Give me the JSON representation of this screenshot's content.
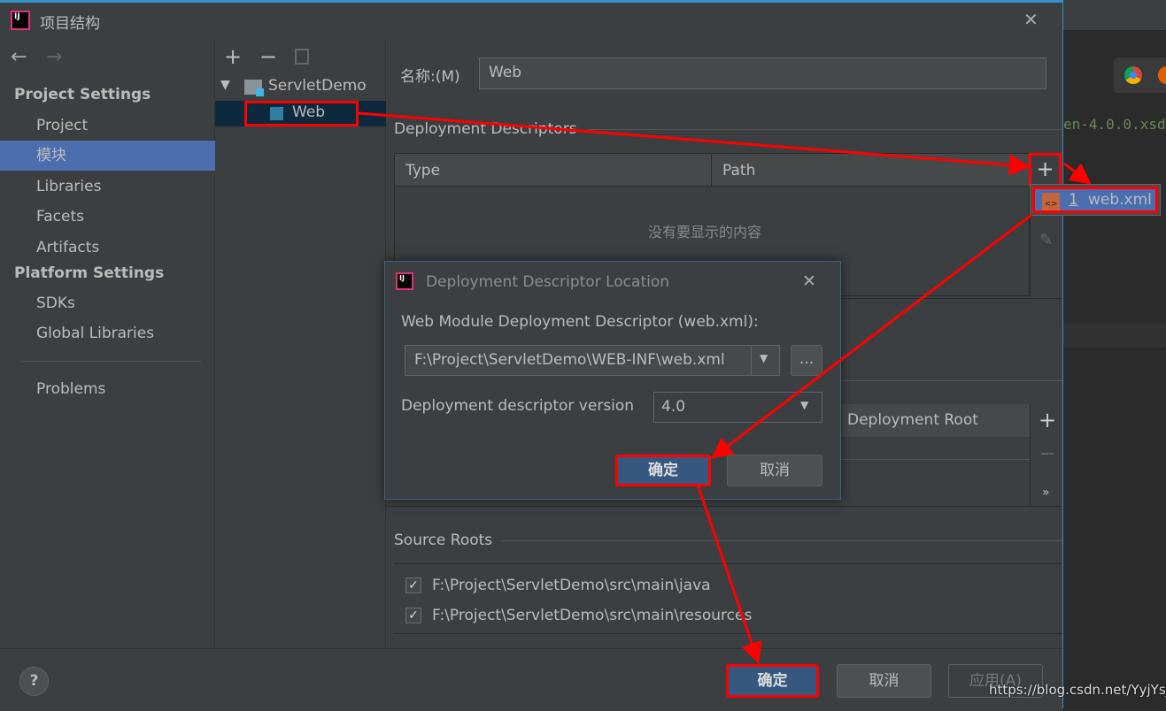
{
  "window": {
    "title": "项目结构",
    "close": "✕"
  },
  "sidebar": {
    "back": "←",
    "forward": "→",
    "project_settings": "Project Settings",
    "items1": [
      "Project",
      "模块",
      "Libraries",
      "Facets",
      "Artifacts"
    ],
    "platform_settings": "Platform Settings",
    "items2": [
      "SDKs",
      "Global Libraries"
    ],
    "problems": "Problems"
  },
  "tree": {
    "add": "+",
    "remove": "−",
    "root": "ServletDemo",
    "child": "Web"
  },
  "content": {
    "name_label": "名称:(M)",
    "name_value": "Web",
    "dd_section": "Deployment Descriptors",
    "dd_columns": [
      "Type",
      "Path"
    ],
    "dd_empty": "没有要显示的内容",
    "add": "+",
    "popup_item_num": "1",
    "popup_item": "web.xml",
    "root_column": "Deployment Root",
    "more": "»",
    "source_roots": "Source Roots",
    "roots": [
      "F:\\Project\\ServletDemo\\src\\main\\java",
      "F:\\Project\\ServletDemo\\src\\main\\resources"
    ]
  },
  "dialog": {
    "title": "Deployment Descriptor Location",
    "close": "✕",
    "label": "Web Module Deployment Descriptor (web.xml):",
    "path": "F:\\Project\\ServletDemo\\WEB-INF\\web.xml",
    "browse": "...",
    "version_label": "Deployment descriptor version",
    "version": "4.0",
    "ok": "确定",
    "cancel": "取消"
  },
  "bottom": {
    "help": "?",
    "ok": "确定",
    "cancel": "取消",
    "apply": "应用(A)"
  },
  "editor": {
    "code": "en-4.0.0.xsd"
  },
  "watermark": "https://blog.csdn.net/YyjYsj",
  "colors": {
    "accent": "#4b6eaf",
    "annotation": "#ff0000",
    "primary_button": "#365880"
  }
}
